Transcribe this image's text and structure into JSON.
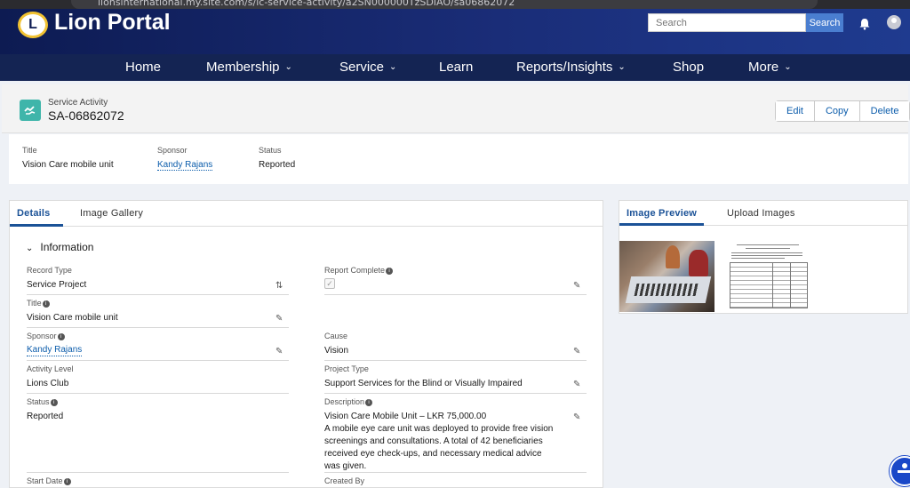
{
  "browser": {
    "url": "lionsinternational.my.site.com/s/lc-service-activity/a2SN000000TzSDIAO/sa06862072"
  },
  "header": {
    "logo_text": "L",
    "title": "Lion Portal",
    "search_placeholder": "Search",
    "search_button": "Search",
    "bell_icon": "bell-icon",
    "avatar_icon": "user-avatar-icon"
  },
  "nav": {
    "items": [
      {
        "label": "Home",
        "has_dropdown": false
      },
      {
        "label": "Membership",
        "has_dropdown": true
      },
      {
        "label": "Service",
        "has_dropdown": true
      },
      {
        "label": "Learn",
        "has_dropdown": false
      },
      {
        "label": "Reports/Insights",
        "has_dropdown": true
      },
      {
        "label": "Shop",
        "has_dropdown": false
      },
      {
        "label": "More",
        "has_dropdown": true
      }
    ]
  },
  "record": {
    "object_label": "Service Activity",
    "name": "SA-06862072",
    "actions": [
      "Edit",
      "Copy",
      "Delete"
    ]
  },
  "highlights": {
    "title_label": "Title",
    "title_value": "Vision Care mobile unit",
    "sponsor_label": "Sponsor",
    "sponsor_value": "Kandy Rajans",
    "status_label": "Status",
    "status_value": "Reported"
  },
  "details": {
    "tabs": [
      "Details",
      "Image Gallery"
    ],
    "section_title": "Information",
    "fields": {
      "record_type": {
        "label": "Record Type",
        "value": "Service Project"
      },
      "report_complete": {
        "label": "Report Complete",
        "checked": true
      },
      "title": {
        "label": "Title",
        "value": "Vision Care mobile unit"
      },
      "sponsor": {
        "label": "Sponsor",
        "value": "Kandy Rajans"
      },
      "cause": {
        "label": "Cause",
        "value": "Vision"
      },
      "activity_level": {
        "label": "Activity Level",
        "value": "Lions Club"
      },
      "project_type": {
        "label": "Project Type",
        "value": "Support Services for the Blind or Visually Impaired"
      },
      "status": {
        "label": "Status",
        "value": "Reported"
      },
      "description": {
        "label": "Description",
        "value": "Vision Care Mobile Unit – LKR 75,000.00\nA mobile eye care unit was deployed to provide free vision screenings and consultations. A total of 42 beneficiaries received eye check-ups, and necessary medical advice was given."
      },
      "start_date": {
        "label": "Start Date"
      },
      "created_by": {
        "label": "Created By"
      }
    }
  },
  "images": {
    "tabs": [
      "Image Preview",
      "Upload Images"
    ]
  }
}
